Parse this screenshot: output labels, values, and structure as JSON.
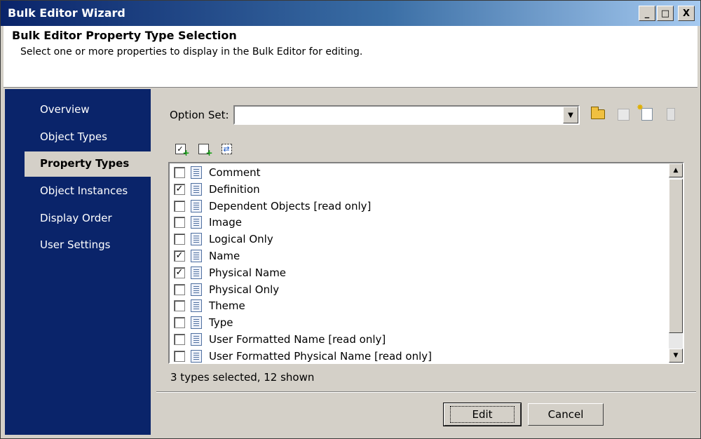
{
  "window": {
    "title": "Bulk Editor Wizard",
    "minimize": "_",
    "maximize": "□",
    "close": "X"
  },
  "header": {
    "title": "Bulk Editor Property Type Selection",
    "subtitle": "Select one or more properties to display in the Bulk Editor for editing."
  },
  "sidebar": {
    "items": [
      {
        "label": "Overview",
        "active": false
      },
      {
        "label": "Object Types",
        "active": false
      },
      {
        "label": "Property Types",
        "active": true
      },
      {
        "label": "Object Instances",
        "active": false
      },
      {
        "label": "Display Order",
        "active": false
      },
      {
        "label": "User Settings",
        "active": false
      }
    ]
  },
  "option_set": {
    "label": "Option Set:",
    "value": ""
  },
  "toolbar_icons": [
    "open-folder-icon",
    "save-icon",
    "new-icon",
    "delete-icon"
  ],
  "list_tools": [
    "select-all-icon",
    "add-selected-icon",
    "invert-selection-icon"
  ],
  "properties": [
    {
      "label": "Comment",
      "checked": false
    },
    {
      "label": "Definition",
      "checked": true
    },
    {
      "label": "Dependent Objects [read only]",
      "checked": false
    },
    {
      "label": "Image",
      "checked": false
    },
    {
      "label": "Logical Only",
      "checked": false
    },
    {
      "label": "Name",
      "checked": true
    },
    {
      "label": "Physical Name",
      "checked": true
    },
    {
      "label": "Physical Only",
      "checked": false
    },
    {
      "label": "Theme",
      "checked": false
    },
    {
      "label": "Type",
      "checked": false
    },
    {
      "label": "User Formatted Name [read only]",
      "checked": false
    },
    {
      "label": "User Formatted Physical Name [read only]",
      "checked": false
    }
  ],
  "status": "3 types selected, 12 shown",
  "buttons": {
    "edit": "Edit",
    "cancel": "Cancel"
  }
}
